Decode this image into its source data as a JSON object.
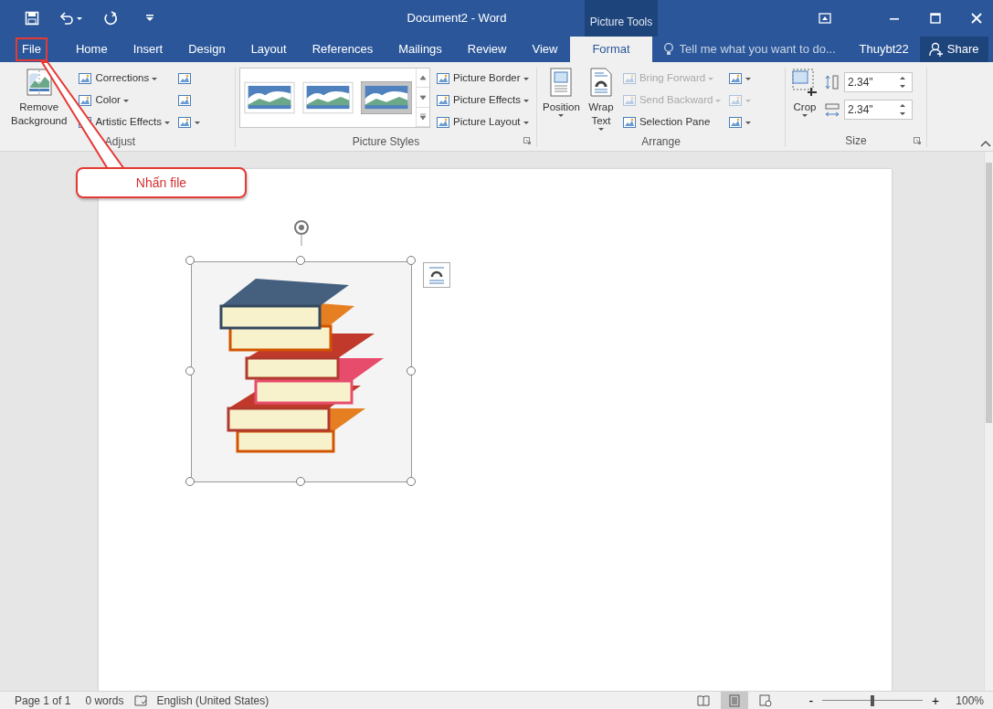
{
  "window": {
    "title": "Document2 - Word",
    "context_group": "Picture Tools"
  },
  "tabs": [
    {
      "label": "File",
      "selected": false,
      "highlighted": true
    },
    {
      "label": "Home",
      "selected": false,
      "highlighted": false
    },
    {
      "label": "Insert",
      "selected": false,
      "highlighted": false
    },
    {
      "label": "Design",
      "selected": false,
      "highlighted": false
    },
    {
      "label": "Layout",
      "selected": false,
      "highlighted": false
    },
    {
      "label": "References",
      "selected": false,
      "highlighted": false
    },
    {
      "label": "Mailings",
      "selected": false,
      "highlighted": false
    },
    {
      "label": "Review",
      "selected": false,
      "highlighted": false
    },
    {
      "label": "View",
      "selected": false,
      "highlighted": false
    },
    {
      "label": "Format",
      "selected": true,
      "highlighted": false
    }
  ],
  "tell_me": {
    "placeholder": "Tell me what you want to do..."
  },
  "user": "Thuybt22",
  "share": "Share",
  "ribbon": {
    "adjust": {
      "label": "Adjust",
      "big_button": {
        "lines": [
          "Remove",
          "Background"
        ]
      },
      "buttons": [
        {
          "label": "Corrections",
          "dropdown": true,
          "disabled": false
        },
        {
          "label": "Color",
          "dropdown": true,
          "disabled": false
        },
        {
          "label": "Artistic Effects",
          "dropdown": true,
          "disabled": false
        }
      ],
      "icon_buttons": [
        {
          "dropdown": false,
          "disabled": false
        },
        {
          "dropdown": false,
          "disabled": false
        },
        {
          "dropdown": true,
          "disabled": false
        }
      ]
    },
    "picture_styles": {
      "label": "Picture Styles",
      "gallery": [
        {
          "kind": "shadow"
        },
        {
          "kind": "shadow"
        },
        {
          "kind": "frame"
        }
      ],
      "buttons": [
        {
          "label": "Picture Border",
          "dropdown": true,
          "disabled": false
        },
        {
          "label": "Picture Effects",
          "dropdown": true,
          "disabled": false
        },
        {
          "label": "Picture Layout",
          "dropdown": true,
          "disabled": false
        }
      ]
    },
    "arrange": {
      "label": "Arrange",
      "big_buttons": [
        {
          "lines": [
            "Position"
          ],
          "dropdown": true
        },
        {
          "lines": [
            "Wrap",
            "Text"
          ],
          "dropdown": true
        }
      ],
      "buttons": [
        {
          "label": "Bring Forward",
          "dropdown": true,
          "disabled": true
        },
        {
          "label": "Send Backward",
          "dropdown": true,
          "disabled": true
        },
        {
          "label": "Selection Pane",
          "dropdown": false,
          "disabled": false
        }
      ],
      "icon_buttons": [
        {
          "dropdown": true,
          "disabled": false
        },
        {
          "dropdown": true,
          "disabled": true
        },
        {
          "dropdown": true,
          "disabled": false
        }
      ]
    },
    "size": {
      "label": "Size",
      "crop": {
        "label": "Crop",
        "dropdown": true
      },
      "height": "2.34\"",
      "width": "2.34\""
    }
  },
  "callout": {
    "text": "Nhấn file"
  },
  "status_bar": {
    "page": "Page 1 of 1",
    "words": "0 words",
    "language": "English (United States)",
    "views": [
      {
        "kind": "read",
        "selected": false
      },
      {
        "kind": "print",
        "selected": true
      },
      {
        "kind": "web",
        "selected": false
      }
    ],
    "zoom_out": "-",
    "zoom_in": "+",
    "zoom": {
      "level": 0.5
    },
    "zoom_text": "100%"
  }
}
